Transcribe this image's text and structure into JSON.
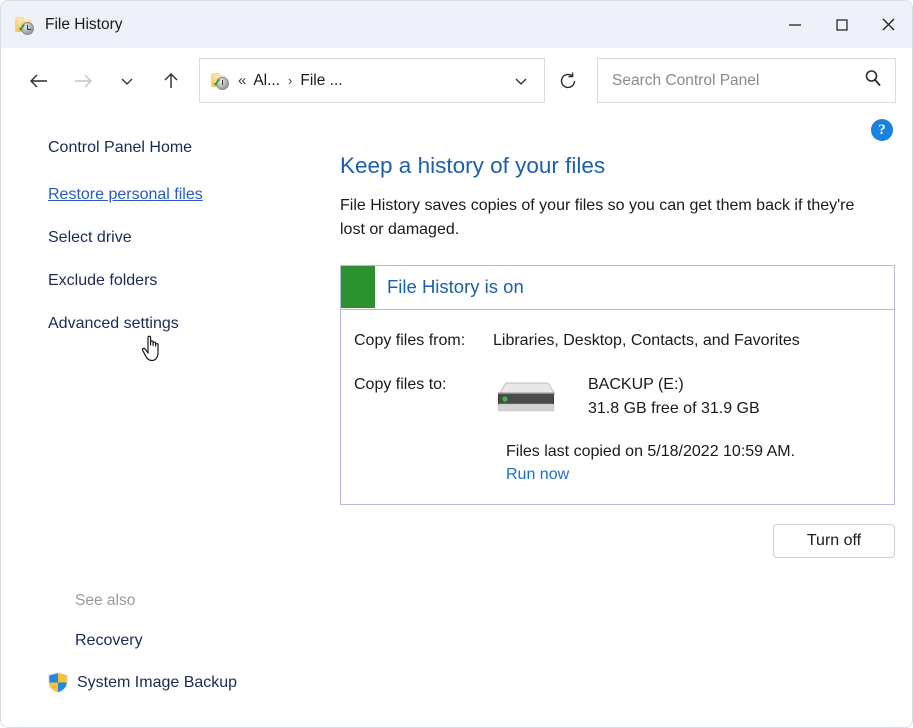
{
  "window": {
    "title": "File History",
    "app_icon": "folder-history-icon",
    "controls": {
      "minimize": "minimize-button",
      "maximize": "maximize-button",
      "close": "close-button"
    }
  },
  "toolbar": {
    "back": "back-arrow-icon",
    "forward": "forward-arrow-icon",
    "recent": "chevron-down-icon",
    "up": "up-arrow-icon",
    "refresh": "refresh-icon",
    "breadcrumb": {
      "icon": "folder-history-icon",
      "chevrons": "«",
      "segments": [
        "Al...",
        "File ..."
      ],
      "separator": "›",
      "dropdown": "chevron-down-icon"
    },
    "search": {
      "placeholder": "Search Control Panel",
      "value": "",
      "icon": "search-icon"
    }
  },
  "sidebar": {
    "items": [
      {
        "label": "Control Panel Home",
        "state": "normal"
      },
      {
        "label": "Restore personal files",
        "state": "hovered"
      },
      {
        "label": "Select drive",
        "state": "normal"
      },
      {
        "label": "Exclude folders",
        "state": "normal"
      },
      {
        "label": "Advanced settings",
        "state": "normal"
      }
    ],
    "see_also": {
      "title": "See also",
      "items": [
        {
          "label": "Recovery",
          "icon": ""
        },
        {
          "label": "System Image Backup",
          "icon": "shield-icon"
        }
      ]
    }
  },
  "main": {
    "help": "?",
    "heading": "Keep a history of your files",
    "description": "File History saves copies of your files so you can get them back if they're lost or damaged.",
    "status": {
      "indicator_color": "#2c9130",
      "title": "File History is on",
      "copy_from_label": "Copy files from:",
      "copy_from_value": "Libraries, Desktop, Contacts, and Favorites",
      "copy_to_label": "Copy files to:",
      "drive_icon": "external-drive-icon",
      "drive_name": "BACKUP (E:)",
      "drive_free": "31.8 GB free of 31.9 GB",
      "last_copied": "Files last copied on 5/18/2022 10:59 AM.",
      "run_now": "Run now"
    },
    "turn_off_button": "Turn off"
  },
  "colors": {
    "titlebar_bg": "#eef1f9",
    "heading_blue": "#1b5fae",
    "link_blue": "#1a6fc4",
    "nav_navy": "#1b2a56",
    "status_green": "#2c9130",
    "panel_border": "#b9bada",
    "help_blue": "#1a81e0"
  }
}
